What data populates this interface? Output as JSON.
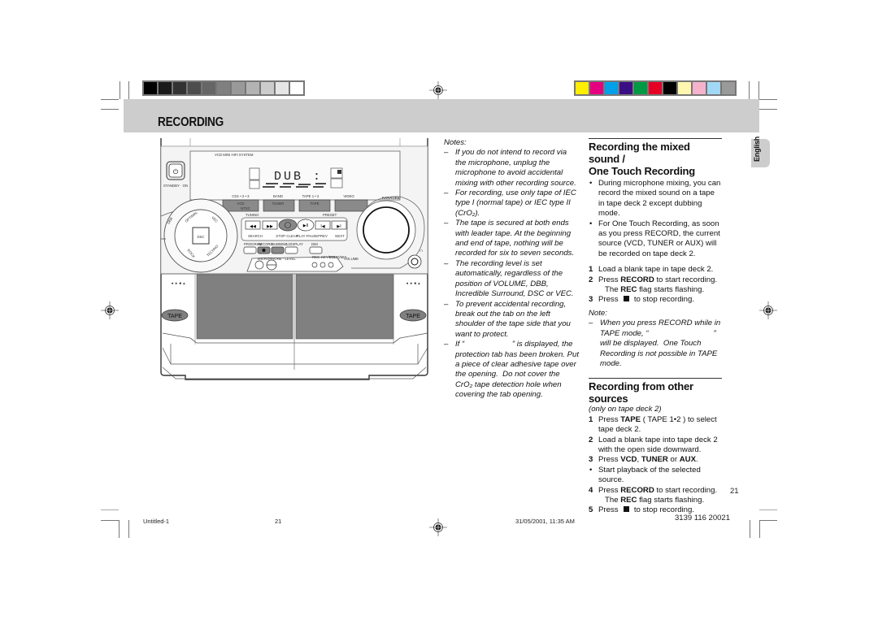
{
  "header": {
    "section_title": "RECORDING",
    "grayscale_swatches": [
      "#000000",
      "#1a1a1a",
      "#333333",
      "#4d4d4d",
      "#666666",
      "#808080",
      "#999999",
      "#b3b3b3",
      "#cccccc",
      "#e6e6e6",
      "#ffffff"
    ],
    "color_swatches": [
      "#ffee00",
      "#e4007f",
      "#00a0e9",
      "#3a0f86",
      "#009944",
      "#e60026",
      "#000000",
      "#fff6b0",
      "#f5b2cb",
      "#a2d8f5",
      "#9a9a9a"
    ],
    "band_color": "#cdcdcd"
  },
  "illustration": {
    "system_name": "VCD MINI HIFI SYSTEM",
    "standby_label": "STANDBY · ON",
    "display_text": "DUB :",
    "source_buttons": [
      {
        "label": "CD1 • 2 • 3",
        "sub": "VCD",
        "sub2": "NTSC"
      },
      {
        "label": "BAND",
        "sub": "TUNER"
      },
      {
        "label": "TAPE 1 • 2",
        "sub": "TAPE"
      },
      {
        "label": "VIDEO",
        "sub": ""
      }
    ],
    "karaoke_logo": "KARAOKE",
    "tuning_label": "TUNING",
    "preset_label": "PRESET",
    "transport_labels": [
      "SEARCH",
      "STOP·CLEAR",
      "PLAY·PAUSE",
      "PREV",
      "NEXT"
    ],
    "function_buttons": [
      "PROGRAM",
      "RECORD",
      "DUBBING",
      "A.DISPLAY",
      "DIM"
    ],
    "mic_label": "MICROPHONE · LEVEL",
    "jack_labels": [
      "REC",
      "KEY/VOL",
      "ECHO/MIX"
    ],
    "volume_label": "VOLUME",
    "dial_labels": [
      "OPTIMAL",
      "DSC",
      "ROCK",
      "TECHNO",
      "VEC",
      "DBB"
    ],
    "center_button": "DSC",
    "deck_labels": [
      "◄ ► ■ ▲",
      "◄ ► ■ ▲"
    ],
    "tape_badges": [
      "TAPE",
      "TAPE"
    ]
  },
  "notes": {
    "heading": "Notes:",
    "items": [
      "If you do not intend to record via the microphone, unplug the microphone to avoid accidental mixing with other recording source.",
      "For recording, use only tape of IEC type I (normal tape) or IEC type II (CrO₂).",
      "The tape is secured at both ends with leader tape.  At the beginning and end of tape, nothing will be recorded for six to seven seconds.",
      "The recording level is set automatically, regardless of the position of VOLUME, DBB, Incredible Surround, DSC or VEC.",
      "To prevent accidental recording, break out the tab on the left shoulder of the tape side that you want to protect.",
      "If “                      ” is displayed, the protection tab has been broken. Put a piece of clear adhesive tape over the opening.  Do not cover the CrO₂ tape detection hole when covering the tab opening."
    ]
  },
  "section_mixed": {
    "heading_line1": "Recording the mixed sound /",
    "heading_line2": "One Touch Recording",
    "bullets": [
      "During microphone mixing, you can record the mixed sound on a tape in tape deck 2 except dubbing mode.",
      "For One Touch Recording, as soon as you press RECORD, the current source (VCD, TUNER or AUX) will be recorded on tape deck 2."
    ],
    "steps": [
      {
        "num": "1",
        "pre": "Load a blank tape in tape deck 2.",
        "bold": "",
        "post": ""
      },
      {
        "num": "2",
        "pre": "Press ",
        "bold": "RECORD",
        "post": " to start recording."
      },
      {
        "num": "3",
        "pre": "Press ",
        "bold": "",
        "post": " to stop recording."
      }
    ],
    "rec_flag_pre": "The ",
    "rec_flag_bold": "REC",
    "rec_flag_post": " flag starts flashing.",
    "note_heading": "Note:",
    "note_text": "When you press RECORD while in TAPE mode, “                              ” will be displayed.  One Touch Recording is not possible in TAPE mode."
  },
  "section_other": {
    "heading": "Recording from other sources",
    "subtitle": "(only on tape deck 2)",
    "step1_pre": "Press ",
    "step1_bold": "TAPE",
    "step1_post": " ( TAPE 1•2 ) to select tape deck 2.",
    "step2": "Load a blank tape into tape deck 2 with the open side downward.",
    "step3_pre": "Press ",
    "step3_b1": "VCD",
    "step3_mid1": ", ",
    "step3_b2": "TUNER",
    "step3_mid2": " or ",
    "step3_b3": "AUX",
    "step3_post": ".",
    "bullet": "Start playback of the selected source.",
    "step4_pre": "Press ",
    "step4_bold": "RECORD",
    "step4_post": " to start recording.",
    "rec_flag_pre": "The ",
    "rec_flag_bold": "REC",
    "rec_flag_post": " flag starts flashing.",
    "step5_pre": "Press ",
    "step5_post": " to stop recording."
  },
  "language_tab": "English",
  "page_number": "21",
  "footer": {
    "file": "Untitled-1",
    "page": "21",
    "datetime": "31/05/2001, 11:35 AM",
    "code": "3139 116 20021"
  }
}
